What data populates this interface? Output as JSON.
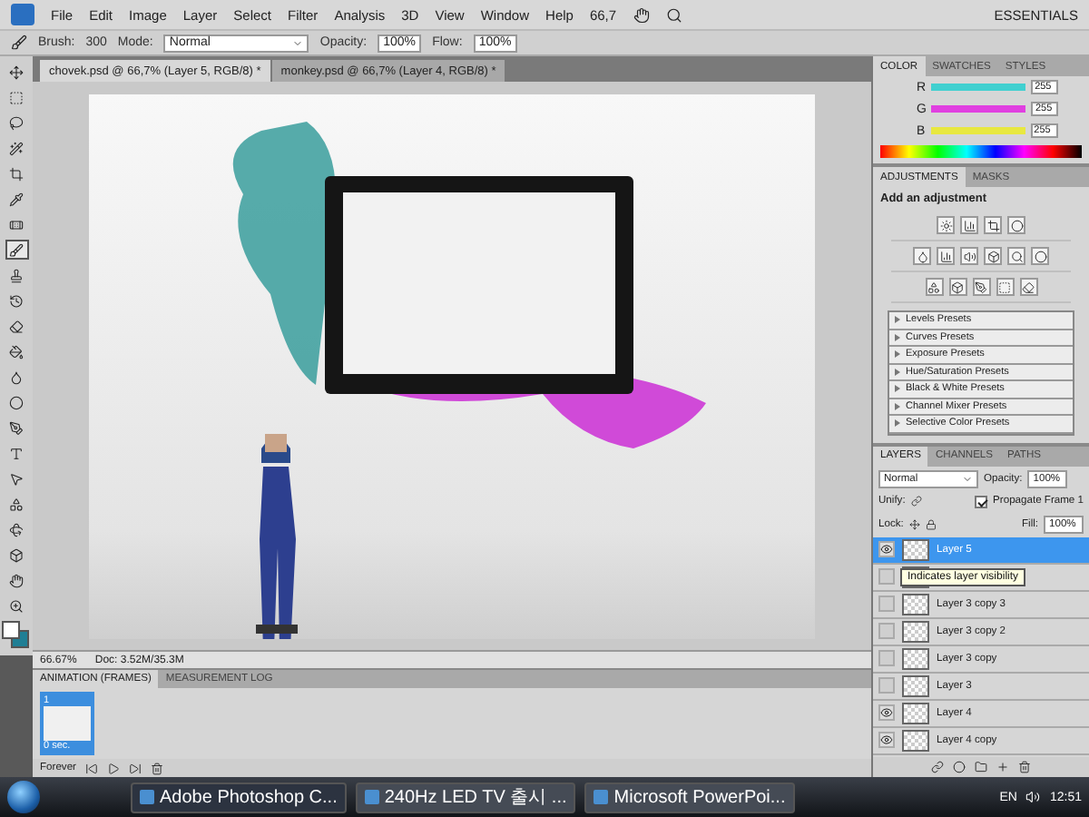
{
  "menu": {
    "items": [
      "File",
      "Edit",
      "Image",
      "Layer",
      "Select",
      "Filter",
      "Analysis",
      "3D",
      "View",
      "Window",
      "Help"
    ],
    "zoom": "66,7",
    "workspace": "ESSENTIALS"
  },
  "options": {
    "brush_label": "Brush:",
    "brush_size": "300",
    "mode_label": "Mode:",
    "mode": "Normal",
    "opacity_label": "Opacity:",
    "opacity": "100%",
    "flow_label": "Flow:",
    "flow": "100%"
  },
  "doc_tabs": [
    {
      "label": "chovek.psd @ 66,7% (Layer 5, RGB/8) *",
      "selected": true
    },
    {
      "label": "monkey.psd @ 66,7% (Layer 4, RGB/8) *",
      "selected": false
    }
  ],
  "tools": [
    {
      "kind": "move",
      "selected": false
    },
    {
      "kind": "marquee",
      "selected": false
    },
    {
      "kind": "lasso",
      "selected": false
    },
    {
      "kind": "wand",
      "selected": false
    },
    {
      "kind": "crop",
      "selected": false
    },
    {
      "kind": "eyedropper",
      "selected": false
    },
    {
      "kind": "heal",
      "selected": false
    },
    {
      "kind": "brush",
      "selected": true
    },
    {
      "kind": "stamp",
      "selected": false
    },
    {
      "kind": "history",
      "selected": false
    },
    {
      "kind": "eraser",
      "selected": false
    },
    {
      "kind": "bucket",
      "selected": false
    },
    {
      "kind": "blur",
      "selected": false
    },
    {
      "kind": "dodge",
      "selected": false
    },
    {
      "kind": "pen",
      "selected": false
    },
    {
      "kind": "type",
      "selected": false
    },
    {
      "kind": "select",
      "selected": false
    },
    {
      "kind": "shape",
      "selected": false
    },
    {
      "kind": "rotate3d",
      "selected": false
    },
    {
      "kind": "orbit3d",
      "selected": false
    },
    {
      "kind": "hand",
      "selected": false
    },
    {
      "kind": "zoom",
      "selected": false
    }
  ],
  "status_bar": {
    "zoom": "66.67%",
    "doc": "Doc: 3.52M/35.3M"
  },
  "animation": {
    "tabs": [
      {
        "label": "ANIMATION (FRAMES)",
        "selected": true
      },
      {
        "label": "MEASUREMENT LOG",
        "selected": false
      }
    ],
    "frames": [
      {
        "number": "1",
        "delay": "0 sec.",
        "selected": true
      }
    ],
    "loop": "Forever"
  },
  "color_panel": {
    "tabs": [
      {
        "label": "COLOR",
        "selected": true
      },
      {
        "label": "SWATCHES",
        "selected": false
      },
      {
        "label": "STYLES",
        "selected": false
      }
    ],
    "sliders": [
      {
        "channel": "R",
        "value": "255",
        "level": 1,
        "color": "#40d0d0"
      },
      {
        "channel": "G",
        "value": "255",
        "level": 1,
        "color": "#e040e0"
      },
      {
        "channel": "B",
        "value": "255",
        "level": 1,
        "color": "#e8e840"
      }
    ]
  },
  "adjustments": {
    "tabs": [
      {
        "label": "ADJUSTMENTS",
        "selected": true
      },
      {
        "label": "MASKS",
        "selected": false
      }
    ],
    "title": "Add an adjustment",
    "presets": [
      "Levels Presets",
      "Curves Presets",
      "Exposure Presets",
      "Hue/Saturation Presets",
      "Black & White Presets",
      "Channel Mixer Presets",
      "Selective Color Presets"
    ]
  },
  "layers_panel": {
    "tabs": [
      {
        "label": "LAYERS",
        "selected": true
      },
      {
        "label": "CHANNELS",
        "selected": false
      },
      {
        "label": "PATHS",
        "selected": false
      }
    ],
    "blend_mode": "Normal",
    "opacity_label": "Opacity:",
    "opacity": "100%",
    "unify_label": "Unify:",
    "propagate": {
      "label": "Propagate Frame 1",
      "checked": true
    },
    "lock_label": "Lock:",
    "fill_label": "Fill:",
    "fill": "100%",
    "tooltip": "Indicates layer visibility",
    "layers": [
      {
        "name": "Layer 5",
        "visible": true,
        "selected": true
      },
      {
        "visible": false,
        "selected": false
      },
      {
        "name": "Layer 3 copy 3",
        "visible": false,
        "selected": false
      },
      {
        "name": "Layer 3 copy 2",
        "visible": false,
        "selected": false
      },
      {
        "name": "Layer 3 copy",
        "visible": false,
        "selected": false
      },
      {
        "name": "Layer 3",
        "visible": false,
        "selected": false
      },
      {
        "name": "Layer 4",
        "visible": true,
        "selected": false
      },
      {
        "name": "Layer 4 copy",
        "visible": true,
        "selected": false
      }
    ]
  },
  "taskbar": {
    "tasks": [
      {
        "label": "Adobe Photoshop C...",
        "selected": true
      },
      {
        "label": "240Hz LED TV 출시 ...",
        "selected": false
      },
      {
        "label": "Microsoft PowerPoi...",
        "selected": false
      }
    ],
    "language": "EN",
    "time": "12:51"
  }
}
